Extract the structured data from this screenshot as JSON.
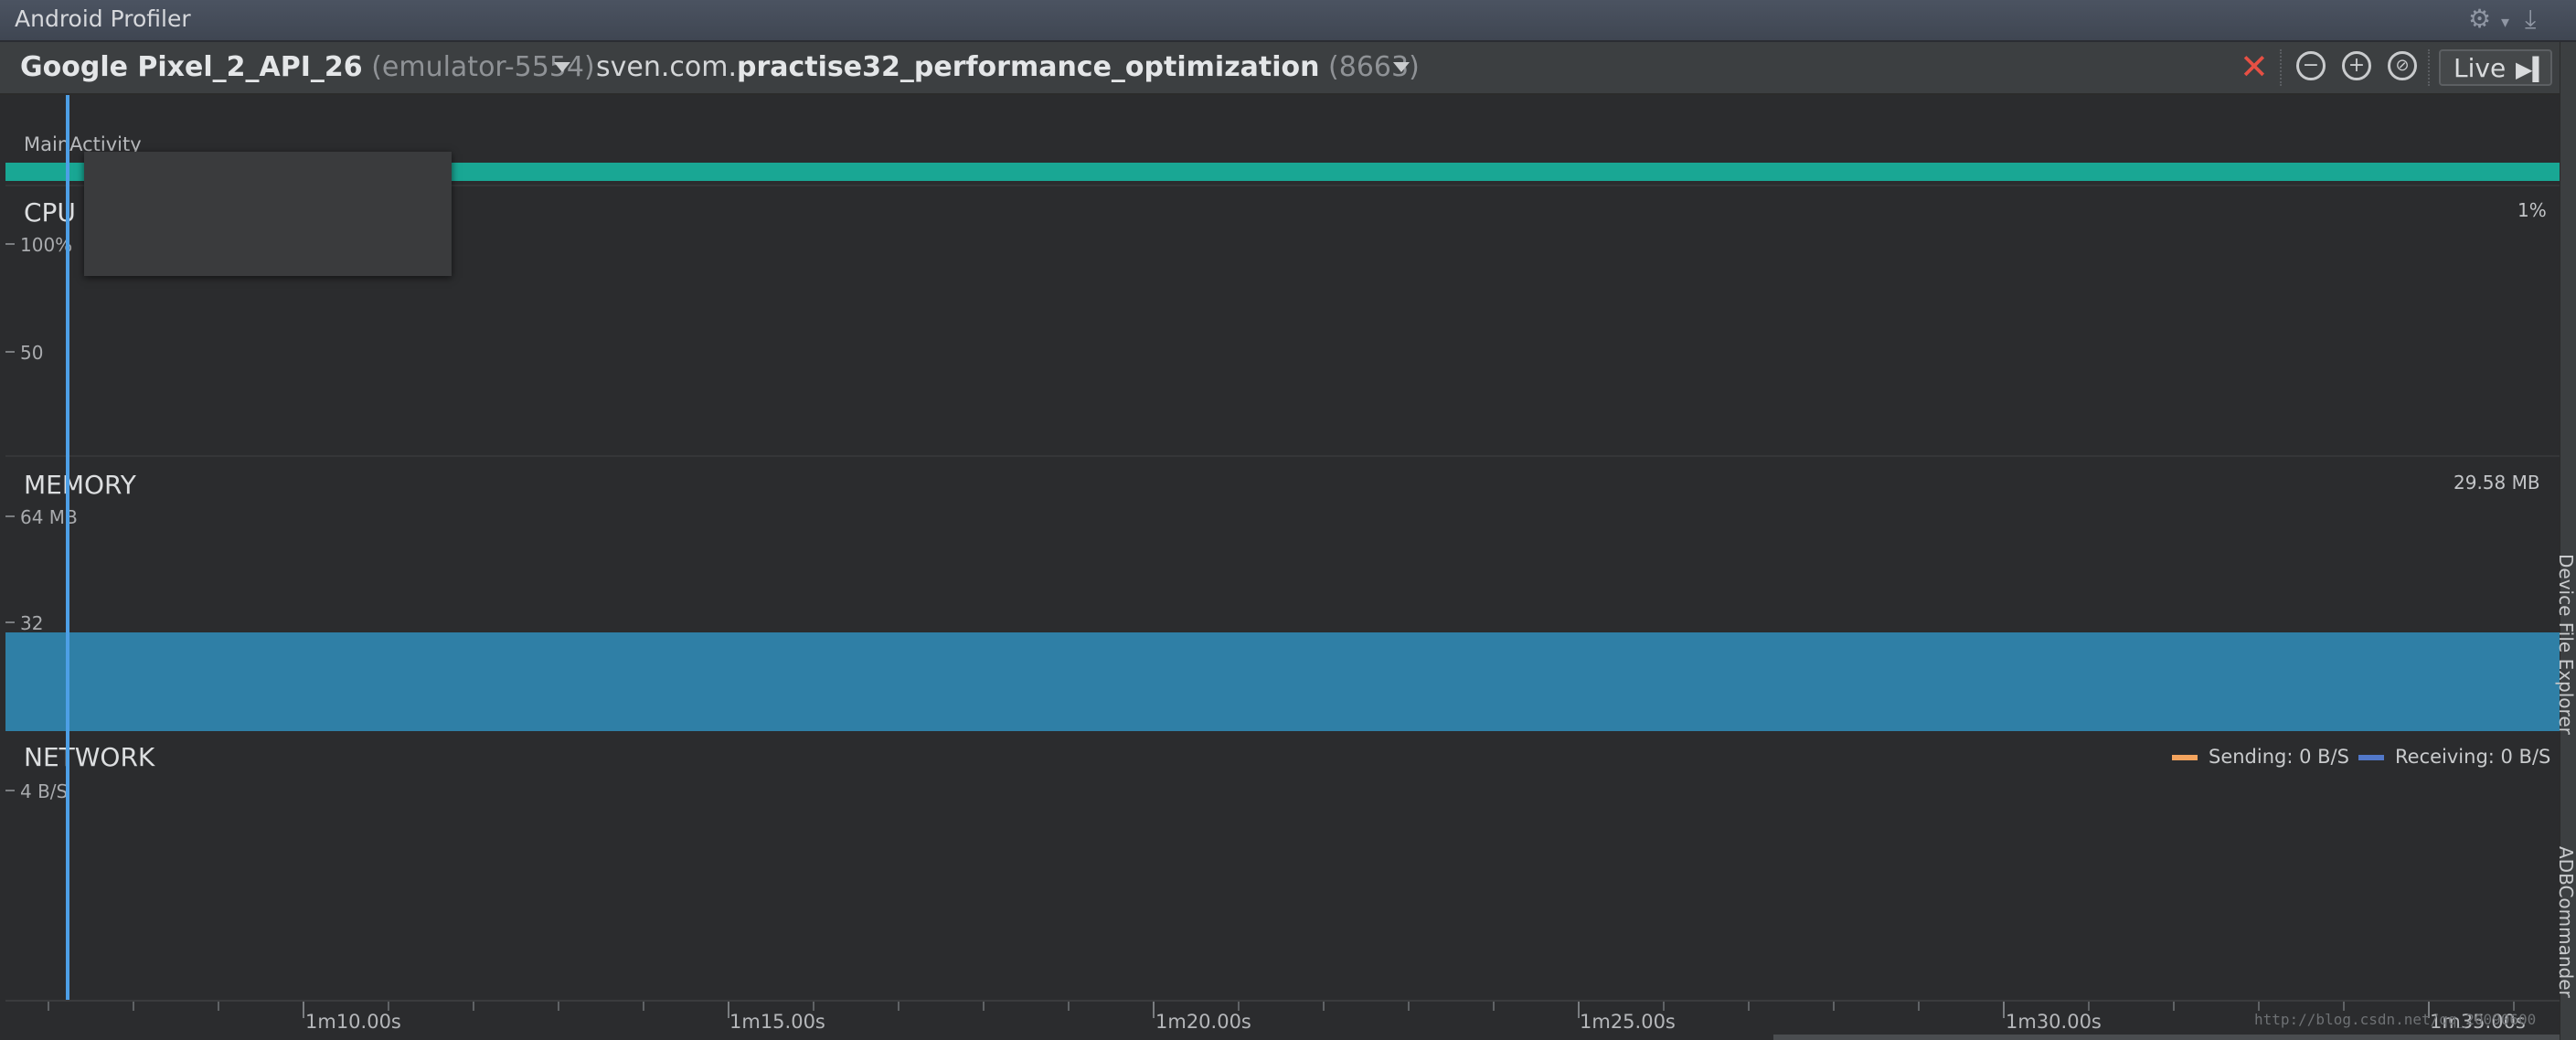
{
  "window": {
    "title": "Android Profiler"
  },
  "toolbar": {
    "device_name": "Google Pixel_2_API_26",
    "device_serial": "(emulator-5554)",
    "process_prefix": "sven.com.",
    "process_name": "practise32_performance_optimization",
    "process_pid": "(8663)",
    "live_label": "Live",
    "icons": [
      "stop-session-icon",
      "zoom-out-icon",
      "zoom-in-icon",
      "reset-zoom-icon",
      "jump-to-live-icon"
    ]
  },
  "activity": {
    "label": "MainActivity",
    "color": "#19a794"
  },
  "cpu": {
    "label": "CPU",
    "axis_top": "100%",
    "axis_mid": "50",
    "current": "1%"
  },
  "memory": {
    "label": "MEMORY",
    "axis_top": "64 MB",
    "axis_mid": "32",
    "current": "29.58 MB",
    "color": "#2f7fa6"
  },
  "network": {
    "label": "NETWORK",
    "axis_top": "4 B/S",
    "sending": "Sending: 0 B/S",
    "receiving": "Receiving: 0 B/S",
    "sending_color": "#f3a45e",
    "receiving_color": "#5278c9"
  },
  "time_axis": {
    "labels": [
      "1m10.00s",
      "1m15.00s",
      "1m20.00s",
      "1m25.00s",
      "1m30.00s",
      "1m35.00s"
    ]
  },
  "side_panel": {
    "tabs": [
      "Device File Explorer",
      "ADBCommander"
    ]
  },
  "watermark": "http://blog.csdn.net/qq_20090600"
}
